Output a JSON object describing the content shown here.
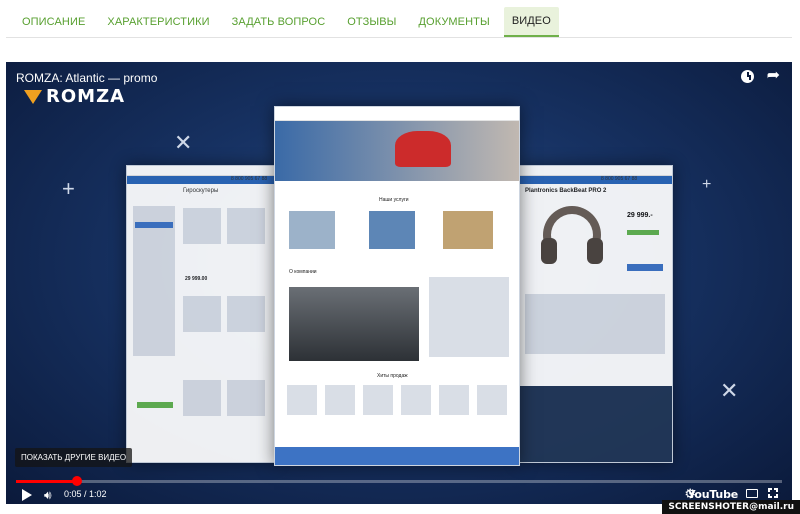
{
  "tabs": [
    {
      "label": "ОПИСАНИЕ"
    },
    {
      "label": "ХАРАКТЕРИСТИКИ"
    },
    {
      "label": "ЗАДАТЬ ВОПРОС"
    },
    {
      "label": "ОТЗЫВЫ"
    },
    {
      "label": "ДОКУМЕНТЫ"
    },
    {
      "label": "ВИДЕО",
      "active": true
    }
  ],
  "video": {
    "title": "ROMZA: Atlantic — promo",
    "channel_logo": "ROMZA",
    "show_more": "ПОКАЗАТЬ ДРУГИЕ ВИДЕО",
    "time": "0:05 / 1:02",
    "progress": 0.08,
    "brand": "YouTube"
  },
  "mockups": {
    "left_heading": "Гироскутеры",
    "left_price": "29 999.00",
    "center_section1": "Наши услуги",
    "center_section2": "О компании",
    "center_section3": "Хиты продаж",
    "right_heading": "Plantronics BackBeat PRO 2",
    "right_price": "29 999.-",
    "phone": "8 800 905 67 88"
  },
  "watermark": "SCREENSHOTER@mail.ru",
  "colors": {
    "accent_green": "#58a030",
    "player_bg": "#173263",
    "progress_red": "#ff0000"
  },
  "icons": [
    "clock-icon",
    "share-icon",
    "play-icon",
    "volume-icon",
    "gear-icon",
    "cc-icon",
    "fullscreen-icon"
  ]
}
